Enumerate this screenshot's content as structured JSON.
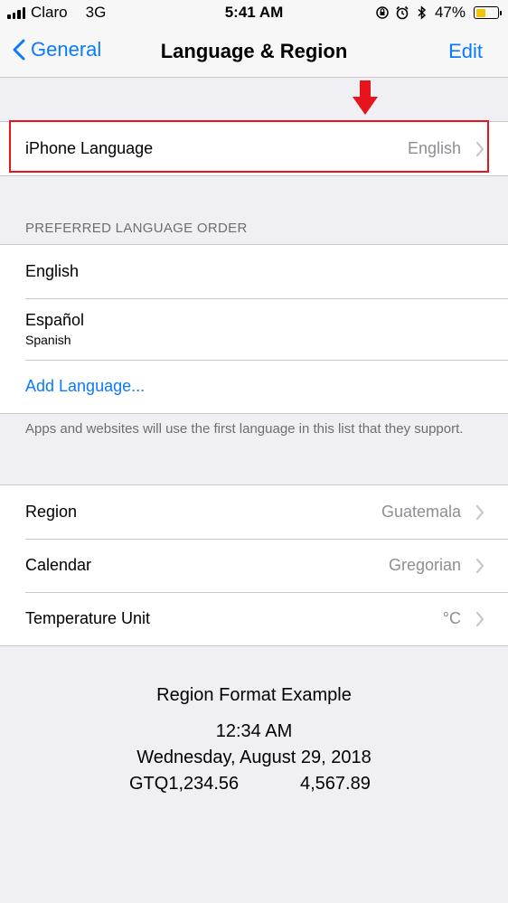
{
  "status_bar": {
    "carrier": "Claro",
    "network": "3G",
    "time": "5:41 AM",
    "battery_percent": "47%",
    "battery_level": 0.47
  },
  "nav": {
    "back_label": "General",
    "title": "Language & Region",
    "edit_label": "Edit"
  },
  "iphone_language": {
    "label": "iPhone Language",
    "value": "English"
  },
  "preferred": {
    "header": "PREFERRED LANGUAGE ORDER",
    "languages": [
      {
        "name": "English"
      },
      {
        "name": "Español",
        "subtitle": "Spanish"
      }
    ],
    "add_label": "Add Language...",
    "footer": "Apps and websites will use the first language in this list that they support."
  },
  "settings": {
    "region": {
      "label": "Region",
      "value": "Guatemala"
    },
    "calendar": {
      "label": "Calendar",
      "value": "Gregorian"
    },
    "temperature": {
      "label": "Temperature Unit",
      "value": "°C"
    }
  },
  "format_example": {
    "title": "Region Format Example",
    "time": "12:34 AM",
    "date": "Wednesday, August 29, 2018",
    "currency": "GTQ1,234.56",
    "number": "4,567.89"
  },
  "colors": {
    "accent": "#0a7aff",
    "annotation": "#e8141b",
    "battery": "#f5c400"
  }
}
